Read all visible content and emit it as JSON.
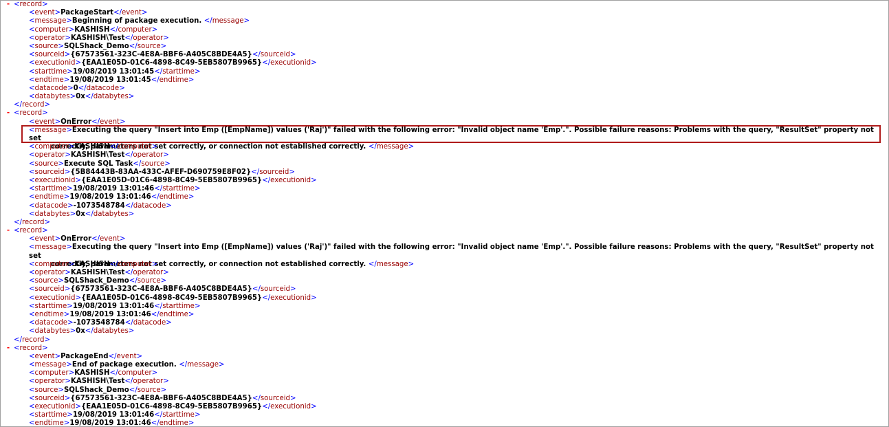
{
  "viewer": {
    "collapse_glyph": "-",
    "record_tag": "record",
    "records": [
      {
        "fields": [
          {
            "tag": "event",
            "value": "PackageStart"
          },
          {
            "tag": "message",
            "value": "Beginning of package execution. "
          },
          {
            "tag": "computer",
            "value": "KASHISH"
          },
          {
            "tag": "operator",
            "value": "KASHISH\\Test"
          },
          {
            "tag": "source",
            "value": "SQLShack_Demo"
          },
          {
            "tag": "sourceid",
            "value": "{67573561-323C-4E8A-BBF6-A405C8BDE4A5}"
          },
          {
            "tag": "executionid",
            "value": "{EAA1E05D-01C6-4898-8C49-5EB5807B9965}"
          },
          {
            "tag": "starttime",
            "value": "19/08/2019 13:01:45"
          },
          {
            "tag": "endtime",
            "value": "19/08/2019 13:01:45"
          },
          {
            "tag": "datacode",
            "value": "0"
          },
          {
            "tag": "databytes",
            "value": "0x"
          }
        ]
      },
      {
        "fields": [
          {
            "tag": "event",
            "value": "OnError"
          },
          {
            "tag": "message",
            "value": "Executing the query \"Insert into Emp ([EmpName]) values ('Raj')\" failed with the following error: \"Invalid object name 'Emp'.\". Possible failure reasons: Problems with the query, \"ResultSet\" property not set",
            "value_cont": "correctly, parameters not set correctly, or connection not established correctly. ",
            "highlight": true
          },
          {
            "tag": "computer",
            "value": "KASHISH"
          },
          {
            "tag": "operator",
            "value": "KASHISH\\Test"
          },
          {
            "tag": "source",
            "value": "Execute SQL Task"
          },
          {
            "tag": "sourceid",
            "value": "{5B84443B-83AA-433C-AFEF-D690759E8F02}"
          },
          {
            "tag": "executionid",
            "value": "{EAA1E05D-01C6-4898-8C49-5EB5807B9965}"
          },
          {
            "tag": "starttime",
            "value": "19/08/2019 13:01:46"
          },
          {
            "tag": "endtime",
            "value": "19/08/2019 13:01:46"
          },
          {
            "tag": "datacode",
            "value": "-1073548784"
          },
          {
            "tag": "databytes",
            "value": "0x"
          }
        ]
      },
      {
        "fields": [
          {
            "tag": "event",
            "value": "OnError"
          },
          {
            "tag": "message",
            "value": "Executing the query \"Insert into Emp ([EmpName]) values ('Raj')\" failed with the following error: \"Invalid object name 'Emp'.\". Possible failure reasons: Problems with the query, \"ResultSet\" property not set",
            "value_cont": "correctly, parameters not set correctly, or connection not established correctly. "
          },
          {
            "tag": "computer",
            "value": "KASHISH"
          },
          {
            "tag": "operator",
            "value": "KASHISH\\Test"
          },
          {
            "tag": "source",
            "value": "SQLShack_Demo"
          },
          {
            "tag": "sourceid",
            "value": "{67573561-323C-4E8A-BBF6-A405C8BDE4A5}"
          },
          {
            "tag": "executionid",
            "value": "{EAA1E05D-01C6-4898-8C49-5EB5807B9965}"
          },
          {
            "tag": "starttime",
            "value": "19/08/2019 13:01:46"
          },
          {
            "tag": "endtime",
            "value": "19/08/2019 13:01:46"
          },
          {
            "tag": "datacode",
            "value": "-1073548784"
          },
          {
            "tag": "databytes",
            "value": "0x"
          }
        ]
      },
      {
        "fields": [
          {
            "tag": "event",
            "value": "PackageEnd"
          },
          {
            "tag": "message",
            "value": "End of package execution. "
          },
          {
            "tag": "computer",
            "value": "KASHISH"
          },
          {
            "tag": "operator",
            "value": "KASHISH\\Test"
          },
          {
            "tag": "source",
            "value": "SQLShack_Demo"
          },
          {
            "tag": "sourceid",
            "value": "{67573561-323C-4E8A-BBF6-A405C8BDE4A5}"
          },
          {
            "tag": "executionid",
            "value": "{EAA1E05D-01C6-4898-8C49-5EB5807B9965}"
          },
          {
            "tag": "starttime",
            "value": "19/08/2019 13:01:46"
          },
          {
            "tag": "endtime",
            "value": "19/08/2019 13:01:46"
          }
        ]
      }
    ]
  },
  "colors": {
    "bracket": "#0000ff",
    "tag": "#990000",
    "toggle": "#ff0000",
    "highlight_border": "#b01b1b"
  }
}
